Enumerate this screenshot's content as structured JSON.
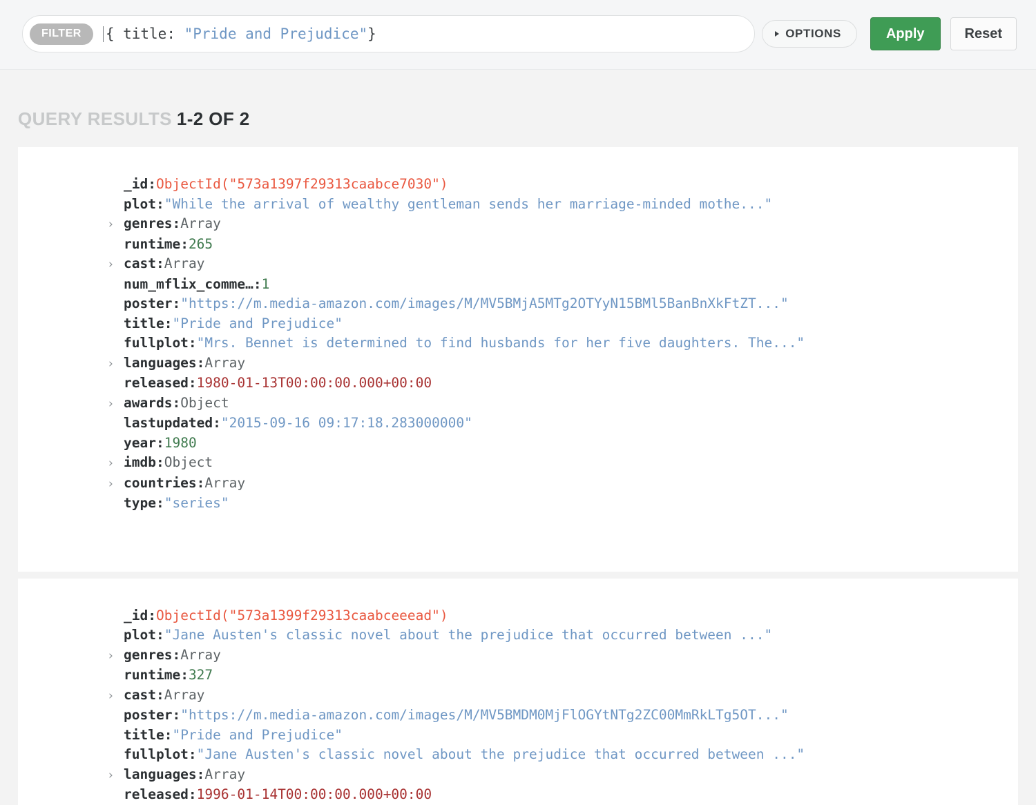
{
  "toolbar": {
    "filter_pill_label": "FILTER",
    "filter_query_prefix": "{ title: ",
    "filter_query_string": "\"Pride and Prejudice\"",
    "filter_query_suffix": "}",
    "options_label": "OPTIONS",
    "apply_label": "Apply",
    "reset_label": "Reset",
    "accent_apply_color": "#3f9c55"
  },
  "results": {
    "header_label": "QUERY RESULTS",
    "header_count": "1-2 OF 2"
  },
  "documents": [
    {
      "fields": [
        {
          "expandable": false,
          "key": "_id",
          "sep": ": ",
          "value": "ObjectId(\"573a1397f29313caabce7030\")",
          "kind": "objectid"
        },
        {
          "expandable": false,
          "key": "plot",
          "sep": ": ",
          "value": "\"While the arrival of wealthy gentleman sends her marriage-minded mothe...\"",
          "kind": "string"
        },
        {
          "expandable": true,
          "key": "genres",
          "sep": ": ",
          "value": "Array",
          "kind": "type"
        },
        {
          "expandable": false,
          "key": "runtime",
          "sep": ": ",
          "value": "265",
          "kind": "number"
        },
        {
          "expandable": true,
          "key": "cast",
          "sep": ": ",
          "value": "Array",
          "kind": "type"
        },
        {
          "expandable": false,
          "key": "num_mflix_comme…",
          "sep": " : ",
          "value": "1",
          "kind": "number"
        },
        {
          "expandable": false,
          "key": "poster",
          "sep": ": ",
          "value": "\"https://m.media-amazon.com/images/M/MV5BMjA5MTg2OTYyN15BMl5BanBnXkFtZT...\"",
          "kind": "string"
        },
        {
          "expandable": false,
          "key": "title",
          "sep": ": ",
          "value": "\"Pride and Prejudice\"",
          "kind": "string"
        },
        {
          "expandable": false,
          "key": "fullplot",
          "sep": ": ",
          "value": "\"Mrs. Bennet is determined to find husbands for her five daughters. The...\"",
          "kind": "string"
        },
        {
          "expandable": true,
          "key": "languages",
          "sep": ": ",
          "value": "Array",
          "kind": "type"
        },
        {
          "expandable": false,
          "key": "released",
          "sep": ": ",
          "value": "1980-01-13T00:00:00.000+00:00",
          "kind": "date"
        },
        {
          "expandable": true,
          "key": "awards",
          "sep": ": ",
          "value": "Object",
          "kind": "type"
        },
        {
          "expandable": false,
          "key": "lastupdated",
          "sep": ": ",
          "value": "\"2015-09-16 09:17:18.283000000\"",
          "kind": "string"
        },
        {
          "expandable": false,
          "key": "year",
          "sep": ": ",
          "value": "1980",
          "kind": "number"
        },
        {
          "expandable": true,
          "key": "imdb",
          "sep": ": ",
          "value": "Object",
          "kind": "type"
        },
        {
          "expandable": true,
          "key": "countries",
          "sep": ": ",
          "value": "Array",
          "kind": "type"
        },
        {
          "expandable": false,
          "key": "type",
          "sep": ": ",
          "value": "\"series\"",
          "kind": "string"
        }
      ]
    },
    {
      "fields": [
        {
          "expandable": false,
          "key": "_id",
          "sep": ": ",
          "value": "ObjectId(\"573a1399f29313caabceeead\")",
          "kind": "objectid"
        },
        {
          "expandable": false,
          "key": "plot",
          "sep": ": ",
          "value": "\"Jane Austen's classic novel about the prejudice that occurred between ...\"",
          "kind": "string"
        },
        {
          "expandable": true,
          "key": "genres",
          "sep": ": ",
          "value": "Array",
          "kind": "type"
        },
        {
          "expandable": false,
          "key": "runtime",
          "sep": ": ",
          "value": "327",
          "kind": "number"
        },
        {
          "expandable": true,
          "key": "cast",
          "sep": ": ",
          "value": "Array",
          "kind": "type"
        },
        {
          "expandable": false,
          "key": "poster",
          "sep": ": ",
          "value": "\"https://m.media-amazon.com/images/M/MV5BMDM0MjFlOGYtNTg2ZC00MmRkLTg5OT...\"",
          "kind": "string"
        },
        {
          "expandable": false,
          "key": "title",
          "sep": ": ",
          "value": "\"Pride and Prejudice\"",
          "kind": "string"
        },
        {
          "expandable": false,
          "key": "fullplot",
          "sep": ": ",
          "value": "\"Jane Austen's classic novel about the prejudice that occurred between ...\"",
          "kind": "string"
        },
        {
          "expandable": true,
          "key": "languages",
          "sep": ": ",
          "value": "Array",
          "kind": "type"
        },
        {
          "expandable": false,
          "key": "released",
          "sep": ": ",
          "value": "1996-01-14T00:00:00.000+00:00",
          "kind": "date"
        }
      ]
    }
  ]
}
